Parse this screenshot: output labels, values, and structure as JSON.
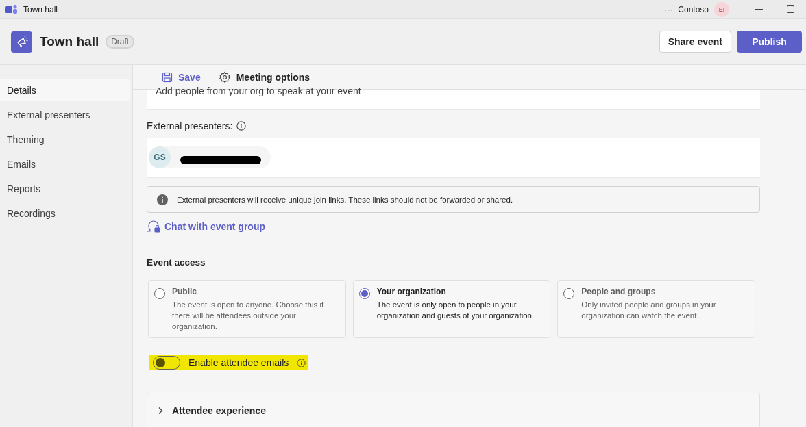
{
  "window": {
    "title": "Town hall",
    "more": "···",
    "org": "Contoso",
    "avatar": "EI"
  },
  "header": {
    "title": "Town hall",
    "badge": "Draft",
    "buttons": [
      {
        "label": "Share event",
        "kind": "secondary"
      },
      {
        "label": "Publish",
        "kind": "primary"
      }
    ]
  },
  "sidebar": {
    "items": [
      {
        "label": "Details",
        "selected": true
      },
      {
        "label": "External presenters",
        "selected": false
      },
      {
        "label": "Theming",
        "selected": false
      },
      {
        "label": "Emails",
        "selected": false
      },
      {
        "label": "Reports",
        "selected": false
      },
      {
        "label": "Recordings",
        "selected": false
      }
    ]
  },
  "toolbar": [
    {
      "label": "Save",
      "kind": "save"
    },
    {
      "label": "Meeting options",
      "kind": "options"
    }
  ],
  "presenters_card": {
    "hint": "Add people from your org to speak at your event"
  },
  "external_presenters": {
    "label": "External presenters:",
    "chips": [
      {
        "initials": "GS",
        "redacted": true
      }
    ]
  },
  "notice": "External presenters will receive unique join links. These links should not be forwarded or shared.",
  "chat_link": "Chat with event group",
  "event_access": {
    "title": "Event access",
    "options": [
      {
        "title": "Public",
        "description": "The event is open to anyone. Choose this if there will be attendees outside your organization.",
        "selected": false
      },
      {
        "title": "Your organization",
        "description": "The event is only open to people in your organization and guests of your organization.",
        "selected": true
      },
      {
        "title": "People and groups",
        "description": "Only invited people and groups in your organization can watch the event.",
        "selected": false
      }
    ]
  },
  "attendee_emails": {
    "label": "Enable attendee emails",
    "on": false,
    "highlighted": true
  },
  "sections": [
    {
      "title": "Attendee experience",
      "expanded": false
    }
  ]
}
